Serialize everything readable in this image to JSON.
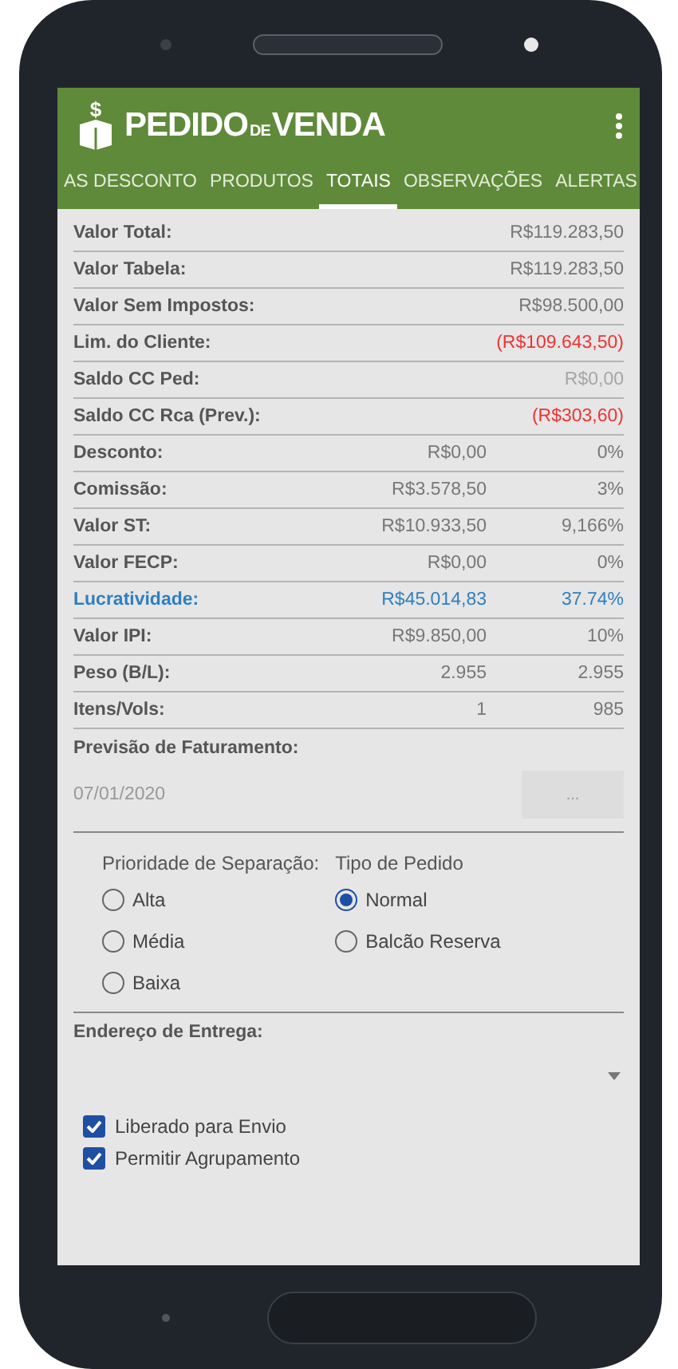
{
  "app_bar": {
    "logo": {
      "symbol": "$",
      "word_1": "PEDIDO",
      "small": "DE",
      "word_2": "VENDA"
    }
  },
  "tabs": [
    {
      "label": "AS DESCONTO",
      "selected": false
    },
    {
      "label": "PRODUTOS",
      "selected": false
    },
    {
      "label": "TOTAIS",
      "selected": true
    },
    {
      "label": "OBSERVAÇÕES",
      "selected": false
    },
    {
      "label": "ALERTAS",
      "selected": false
    }
  ],
  "totals": [
    {
      "label": "Valor Total:",
      "value": "R$119.283,50",
      "color": "#777777",
      "highlighted": false
    },
    {
      "label": "Valor Tabela:",
      "value": "R$119.283,50",
      "color": "#777777",
      "highlighted": false
    },
    {
      "label": "Valor Sem Impostos:",
      "value": "R$98.500,00",
      "color": "#777777",
      "highlighted": false
    },
    {
      "label": "Lim. do Cliente:",
      "value": "(R$109.643,50)",
      "color": "#ee3333",
      "highlighted": false
    },
    {
      "label": "Saldo CC Ped:",
      "value": "R$0,00",
      "color": "#a6a6a6",
      "highlighted": false
    },
    {
      "label": "Saldo CC Rca (Prev.):",
      "value": "(R$303,60)",
      "color": "#ee3333",
      "highlighted": false
    },
    {
      "label": "Desconto:",
      "value": "R$0,00",
      "share": "0%",
      "color": "#777777",
      "highlighted": false
    },
    {
      "label": "Comissão:",
      "value": "R$3.578,50",
      "share": "3%",
      "color": "#777777",
      "highlighted": false
    },
    {
      "label": "Valor ST:",
      "value": "R$10.933,50",
      "share": "9,166%",
      "color": "#777777",
      "highlighted": false
    },
    {
      "label": "Valor FECP:",
      "value": "R$0,00",
      "share": "0%",
      "color": "#777777",
      "highlighted": false
    },
    {
      "label": "Lucratividade:",
      "value": "R$45.014,83",
      "share": "37.74%",
      "color": "#2f7fc0",
      "highlighted": true
    },
    {
      "label": "Valor IPI:",
      "value": "R$9.850,00",
      "share": "10%",
      "color": "#777777",
      "highlighted": false
    },
    {
      "label": "Peso (B/L):",
      "value": "2.955",
      "share": "2.955",
      "color": "#777777",
      "highlighted": false
    },
    {
      "label": "Itens/Vols:",
      "value": "1",
      "share": "985",
      "color": "#777777",
      "highlighted": false
    }
  ],
  "billing_forecast": {
    "label": "Previsão de Faturamento:",
    "value": "07/01/2020",
    "button": "..."
  },
  "radio_groups": [
    {
      "title": "Prioridade de Separação:",
      "options": [
        {
          "label": "Alta",
          "selected": false
        },
        {
          "label": "Média",
          "selected": false
        },
        {
          "label": "Baixa",
          "selected": false
        }
      ]
    },
    {
      "title": "Tipo de Pedido",
      "options": [
        {
          "label": "Normal",
          "selected": true
        },
        {
          "label": "Balcão Reserva",
          "selected": false
        }
      ]
    }
  ],
  "delivery_address": {
    "label": "Endereço de Entrega:"
  },
  "checkboxes": [
    {
      "label": "Liberado para Envio",
      "checked": true
    },
    {
      "label": "Permitir Agrupamento",
      "checked": true
    }
  ]
}
